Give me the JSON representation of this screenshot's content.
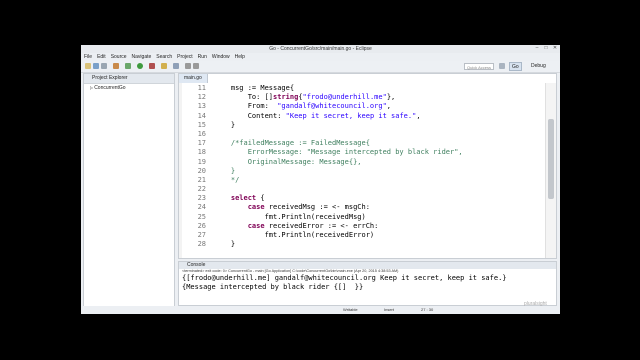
{
  "window": {
    "title": "Go - ConcurrentGo/src/main/main.go - Eclipse"
  },
  "menu": [
    "File",
    "Edit",
    "Source",
    "Navigate",
    "Search",
    "Project",
    "Run",
    "Window",
    "Help"
  ],
  "toolbar": {
    "quick_access": "Quick Access",
    "perspectives": [
      "Go",
      "Debug"
    ]
  },
  "project_explorer": {
    "title": "Project Explorer",
    "items": [
      "ConcurrentGo"
    ]
  },
  "editor": {
    "tab": "main.go",
    "lines": [
      {
        "num": "11",
        "text": "    msg := Message{"
      },
      {
        "num": "12",
        "text": "        To: []string{\"frodo@underhill.me\"},"
      },
      {
        "num": "13",
        "text": "        From:  \"gandalf@whitecouncil.org\","
      },
      {
        "num": "14",
        "text": "        Content: \"Keep it secret, keep it safe.\","
      },
      {
        "num": "15",
        "text": "    }"
      },
      {
        "num": "16",
        "text": ""
      },
      {
        "num": "17",
        "text": "    /*failedMessage := FailedMessage{"
      },
      {
        "num": "18",
        "text": "        ErrorMessage: \"Message intercepted by black rider\","
      },
      {
        "num": "19",
        "text": "        OriginalMessage: Message{},"
      },
      {
        "num": "20",
        "text": "    }"
      },
      {
        "num": "21",
        "text": "    */"
      },
      {
        "num": "22",
        "text": ""
      },
      {
        "num": "23",
        "text": "    select {"
      },
      {
        "num": "24",
        "text": "        case receivedMsg := <- msgCh:"
      },
      {
        "num": "25",
        "text": "            fmt.Println(receivedMsg)"
      },
      {
        "num": "26",
        "text": "        case receivedError := <- errCh:"
      },
      {
        "num": "27",
        "text": "            fmt.Println(receivedError)"
      },
      {
        "num": "28",
        "text": "    }"
      }
    ]
  },
  "console": {
    "title": "Console",
    "terminated": "<terminated> exit code: 0> ConcurrentGo - main [Go Application] C:\\code\\ConcurrentGo\\bin\\main.exe (Apr 20, 2015 4:38:53 AM)",
    "output": [
      "{[frodo@underhill.me] gandalf@whitecouncil.org Keep it secret, keep it safe.}",
      "{Message intercepted by black rider {[]  }}"
    ]
  },
  "status": {
    "writable": "Writable",
    "insert": "Insert",
    "position": "27 : 30"
  },
  "watermark": "pluralsight",
  "colors": {
    "keyword": "#7f0055",
    "string": "#2a00ff",
    "comment": "#3f7f5f",
    "background": "#000000"
  }
}
